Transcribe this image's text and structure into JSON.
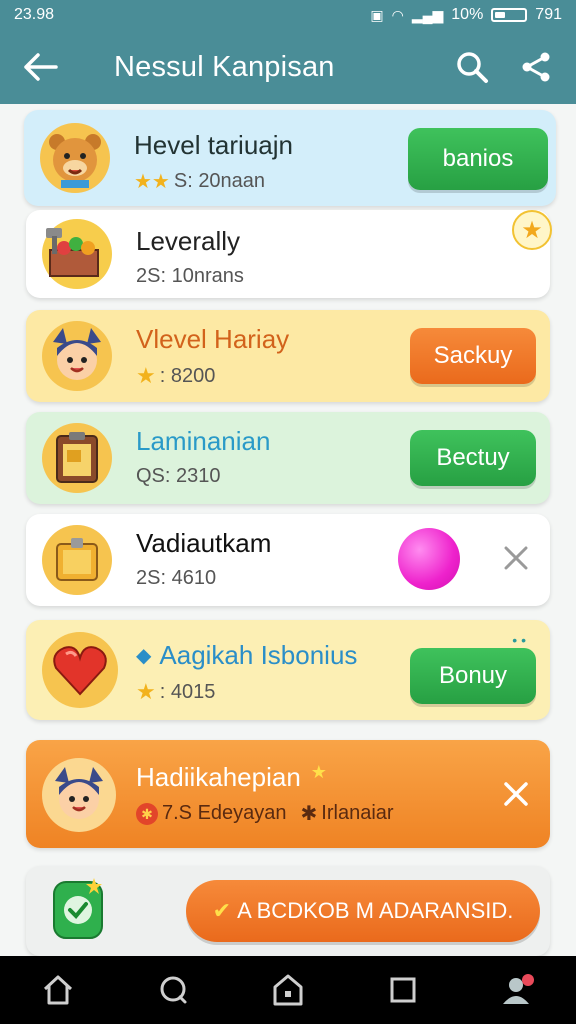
{
  "status": {
    "time": "23.98",
    "battery_text": "10%",
    "right_time": "791"
  },
  "appbar": {
    "title": "Nessul Kanpisan"
  },
  "cards": [
    {
      "title": "Hevel tariuajn",
      "sub": "S: 20naan",
      "button": "banios"
    },
    {
      "title": "Leverally",
      "sub": "2S: 10nrans"
    },
    {
      "title": "Vlevel Hariay",
      "sub": ": 8200",
      "button": "Sackuy"
    },
    {
      "title": "Laminanian",
      "sub": "QS: 2310",
      "button": "Bectuy"
    },
    {
      "title": "Vadiautkam",
      "sub": "2S: 4610"
    },
    {
      "title": "Aagikah Isbonius",
      "sub": ": 4015",
      "button": "Bonuy"
    },
    {
      "title": "Hadiikahepian",
      "sub_a": "7.S Edeyayan",
      "sub_b": "Irlanaiar"
    }
  ],
  "promo": {
    "label": "A BCDKOB M ADARANSID."
  },
  "colors": {
    "header": "#4a8d97",
    "green": "#2fb04d",
    "orange": "#ef7424"
  }
}
